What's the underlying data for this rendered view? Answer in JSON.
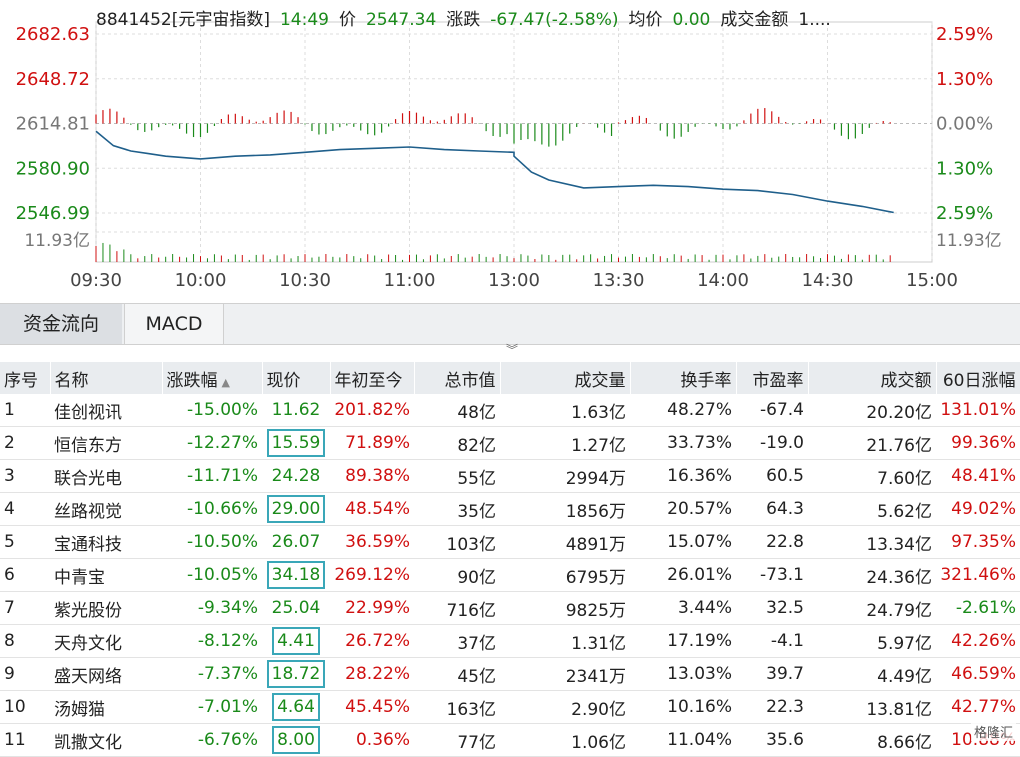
{
  "info": {
    "code_name": "8841452[元宇宙指数]",
    "time": "14:49",
    "price_label": "价",
    "price": "2547.34",
    "change_label": "涨跌",
    "change": "-67.47(-2.58%)",
    "avg_label": "均价",
    "avg": "0.00",
    "turnover_label": "成交金额",
    "turnover": "1...."
  },
  "chart_data": {
    "type": "line",
    "y_left": [
      "2682.63",
      "2648.72",
      "2614.81",
      "2580.90",
      "2546.99"
    ],
    "y_right": [
      "2.59%",
      "1.30%",
      "0.00%",
      "1.30%",
      "2.59%"
    ],
    "y_base": 2614.81,
    "ylim": [
      2546.99,
      2682.63
    ],
    "volume_label_left": "11.93亿",
    "volume_label_right": "11.93亿",
    "x_ticks": [
      "09:30",
      "10:00",
      "10:30",
      "11:00",
      "13:00",
      "13:30",
      "14:00",
      "14:30",
      "15:00"
    ],
    "series": [
      {
        "x": [
          "09:30",
          "09:35",
          "09:40",
          "09:45",
          "09:50",
          "09:55",
          "10:00",
          "10:10",
          "10:20",
          "10:30",
          "10:40",
          "10:50",
          "11:00",
          "11:10",
          "11:20",
          "11:30",
          "13:00",
          "13:05",
          "13:10",
          "13:20",
          "13:30",
          "13:40",
          "13:50",
          "14:00",
          "14:10",
          "14:20",
          "14:30",
          "14:40",
          "14:49"
        ],
        "values": [
          2609,
          2598,
          2594,
          2592,
          2590,
          2589,
          2588,
          2590,
          2591,
          2593,
          2595,
          2596,
          2597,
          2595,
          2594,
          2593,
          2590,
          2578,
          2572,
          2566,
          2567,
          2568,
          2567,
          2565,
          2564,
          2561,
          2556,
          2552,
          2547.34
        ]
      }
    ]
  },
  "tabs": {
    "active": "资金流向",
    "other": "MACD"
  },
  "table": {
    "headers": [
      "序号",
      "名称",
      "涨跌幅",
      "现价",
      "年初至今",
      "总市值",
      "成交量",
      "换手率",
      "市盈率",
      "成交额",
      "60日涨幅"
    ],
    "sort_arrow": "▲",
    "rows": [
      [
        "1",
        "佳创视讯",
        "-15.00%",
        "11.62",
        "201.82%",
        "48亿",
        "1.63亿",
        "48.27%",
        "-67.4",
        "20.20亿",
        "131.01%"
      ],
      [
        "2",
        "恒信东方",
        "-12.27%",
        "15.59",
        "71.89%",
        "82亿",
        "1.27亿",
        "33.73%",
        "-19.0",
        "21.76亿",
        "99.36%"
      ],
      [
        "3",
        "联合光电",
        "-11.71%",
        "24.28",
        "89.38%",
        "55亿",
        "2994万",
        "16.36%",
        "60.5",
        "7.60亿",
        "48.41%"
      ],
      [
        "4",
        "丝路视觉",
        "-10.66%",
        "29.00",
        "48.54%",
        "35亿",
        "1856万",
        "20.57%",
        "64.3",
        "5.62亿",
        "49.02%"
      ],
      [
        "5",
        "宝通科技",
        "-10.50%",
        "26.07",
        "36.59%",
        "103亿",
        "4891万",
        "15.07%",
        "22.8",
        "13.34亿",
        "97.35%"
      ],
      [
        "6",
        "中青宝",
        "-10.05%",
        "34.18",
        "269.12%",
        "90亿",
        "6795万",
        "26.01%",
        "-73.1",
        "24.36亿",
        "321.46%"
      ],
      [
        "7",
        "紫光股份",
        "-9.34%",
        "25.04",
        "22.99%",
        "716亿",
        "9825万",
        "3.44%",
        "32.5",
        "24.79亿",
        "-2.61%"
      ],
      [
        "8",
        "天舟文化",
        "-8.12%",
        "4.41",
        "26.72%",
        "37亿",
        "1.31亿",
        "17.19%",
        "-4.1",
        "5.97亿",
        "42.26%"
      ],
      [
        "9",
        "盛天网络",
        "-7.37%",
        "18.72",
        "28.22%",
        "45亿",
        "2341万",
        "13.03%",
        "39.7",
        "4.49亿",
        "46.59%"
      ],
      [
        "10",
        "汤姆猫",
        "-7.01%",
        "4.64",
        "45.45%",
        "163亿",
        "2.90亿",
        "10.16%",
        "22.3",
        "13.81亿",
        "42.77%"
      ],
      [
        "11",
        "凯撒文化",
        "-6.76%",
        "8.00",
        "0.36%",
        "77亿",
        "1.06亿",
        "11.04%",
        "35.6",
        "8.66亿",
        "10.88%"
      ]
    ],
    "boxed_price_rows": [
      1,
      3,
      5,
      7,
      8,
      9,
      10
    ]
  },
  "watermark": "格隆汇",
  "colors": {
    "up": "#d01010",
    "down": "#1a8a1a",
    "line": "#1f5f8b",
    "box": "#3aa7b8"
  }
}
